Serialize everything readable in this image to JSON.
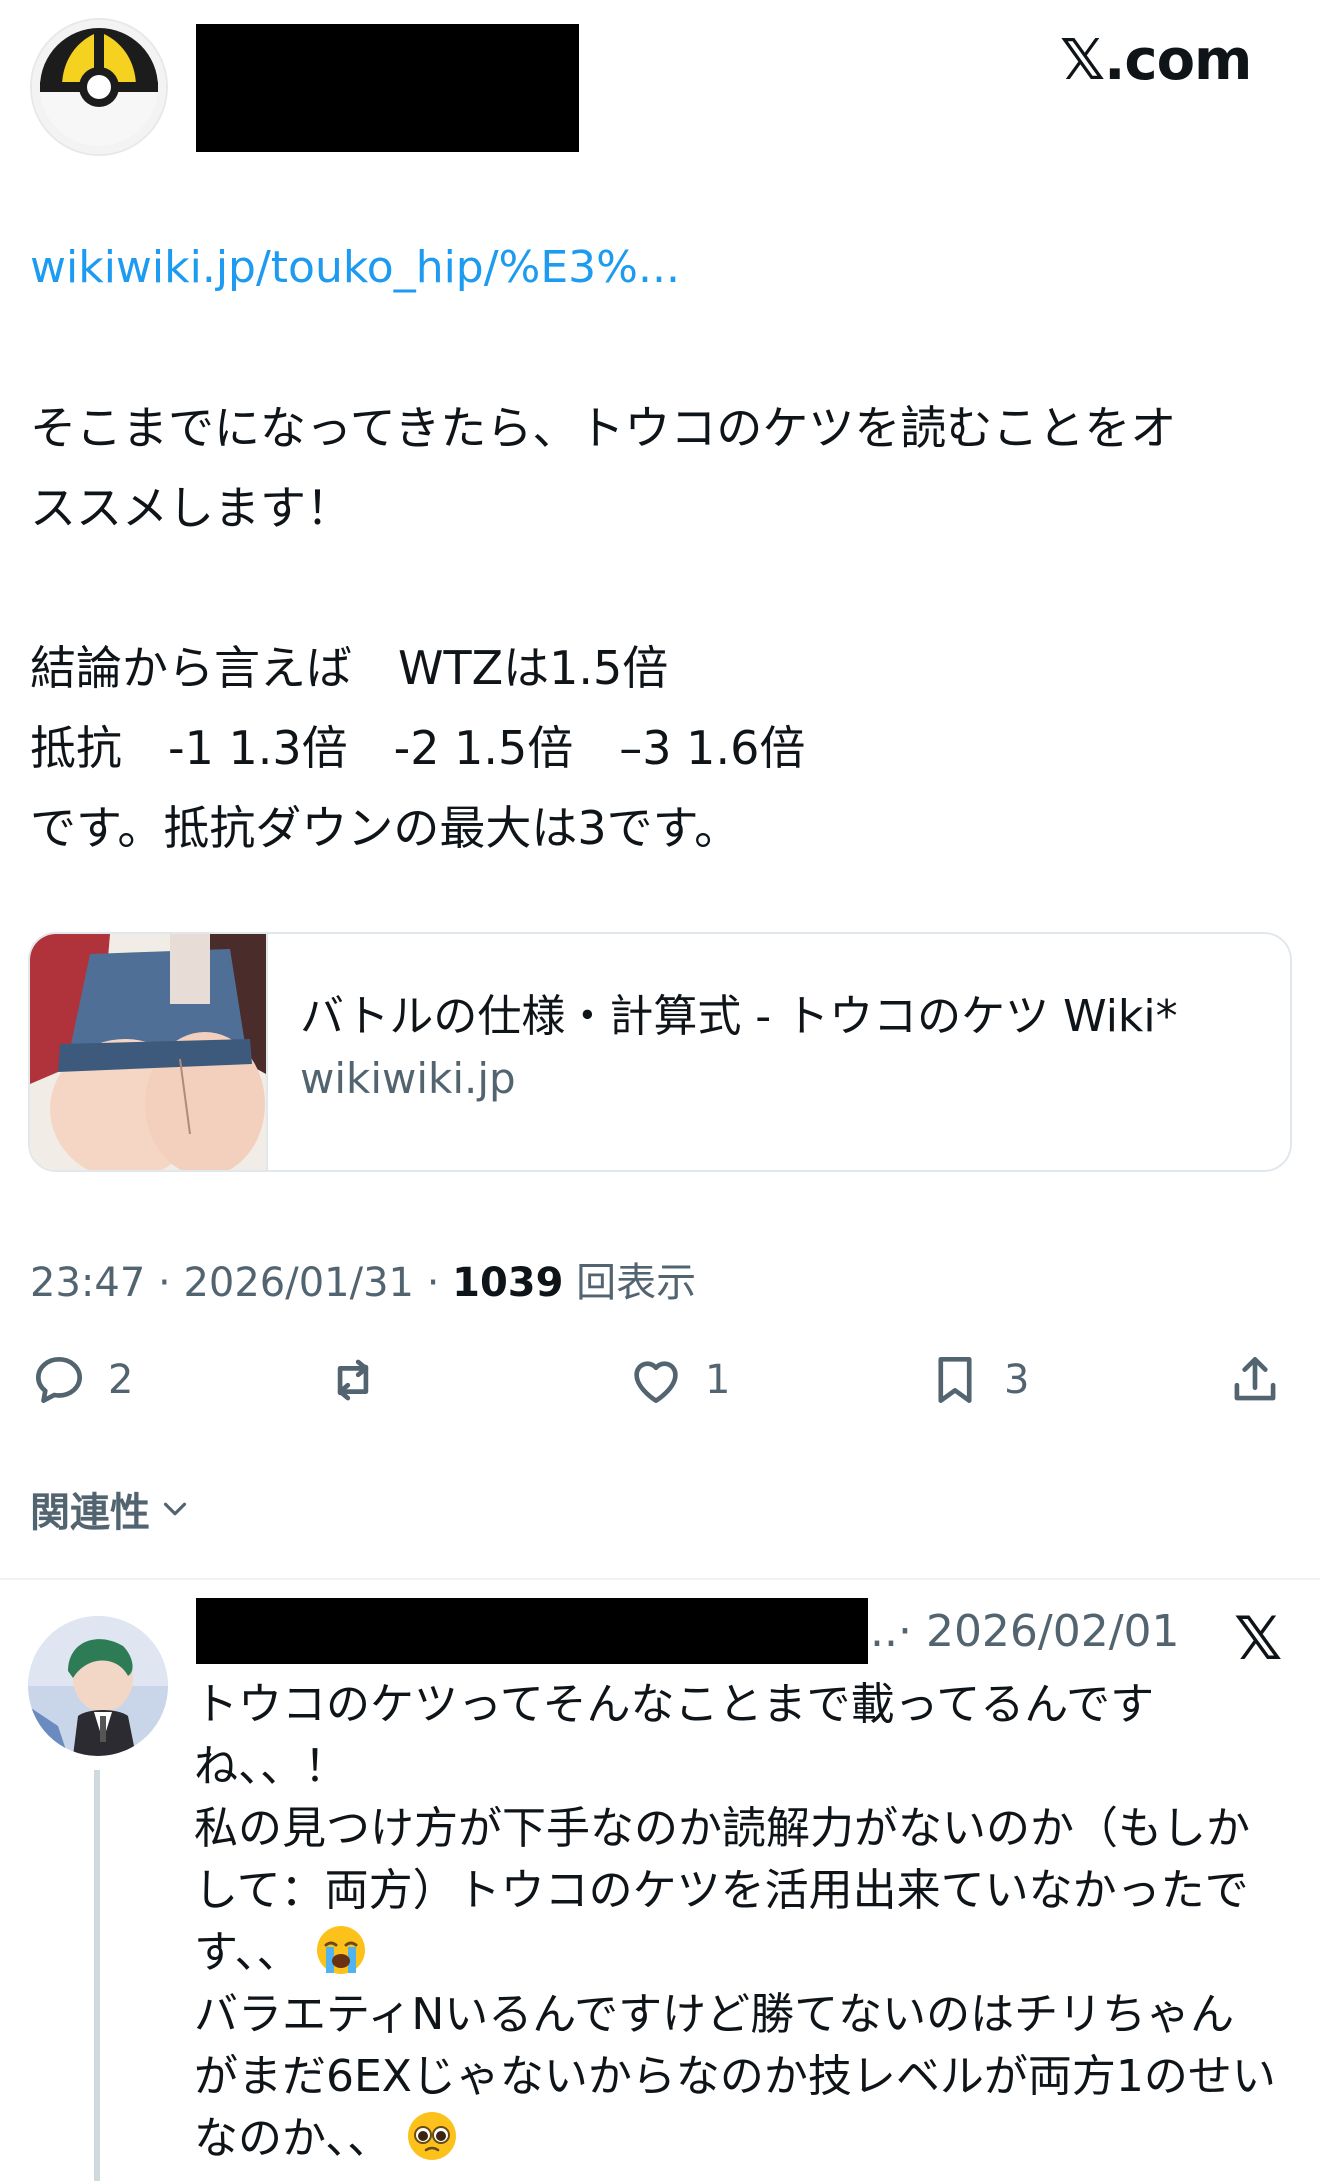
{
  "tweet": {
    "brand": "𝕏.com",
    "link_url": "wikiwiki.jp/touko_hip/%E3%...",
    "body_lines": [
      "そこまでになってきたら、トウコのケツを読むことをオ",
      "ススメします！",
      "",
      "結論から言えば　WTZは1.5倍",
      "抵抗　-1 1.3倍　-2 1.5倍　–3 1.6倍",
      "です。抵抗ダウンの最大は3です。"
    ],
    "card": {
      "title": "バトルの仕様・計算式 - トウコのケツ Wiki*",
      "domain": "wikiwiki.jp"
    },
    "meta": {
      "time": "23:47",
      "sep1": " · ",
      "date": "2026/01/31",
      "sep2": " · ",
      "views": "1039",
      "views_label": " 回表示"
    },
    "actions": {
      "replies": "2",
      "reposts": "",
      "likes": "1",
      "bookmarks": "3"
    },
    "relevance_label": "関連性"
  },
  "reply": {
    "meta": "..· 2026/02/01",
    "x_mark": "𝕏",
    "lines": [
      "トウコのケツってそんなことまで載ってるんです",
      "ね、、！",
      "私の見つけ方が下手なのか読解力がないのか（もしか",
      "して：両方）トウコのケツを活用出来ていなかったで",
      "す、、",
      "バラエティNいるんですけど勝てないのはチリちゃん",
      "がまだ6EXじゃないからなのか技レベルが両方1のせい",
      "なのか、、"
    ],
    "emojis": [
      "loudly-crying-face",
      "pleading-face"
    ]
  }
}
